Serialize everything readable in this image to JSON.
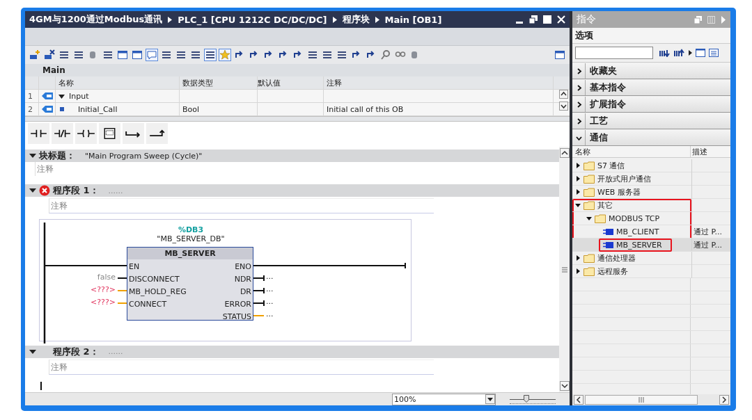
{
  "window": {
    "path": [
      "4GM与1200通过Modbus通讯",
      "PLC_1 [CPU 1212C DC/DC/DC]",
      "程序块",
      "Main [OB1]"
    ]
  },
  "interface": {
    "title": "Main",
    "columns": [
      "名称",
      "数据类型",
      "默认值",
      "注释"
    ],
    "rows": [
      {
        "num": "1",
        "name": "Input",
        "kind": "section",
        "expanded": true
      },
      {
        "num": "2",
        "name": "Initial_Call",
        "type": "Bool",
        "comment": "Initial call of this OB",
        "kind": "param"
      }
    ]
  },
  "block_title": {
    "label": "块标题：",
    "value": "\"Main Program Sweep (Cycle)\"",
    "comment": "注释",
    "expanded": true
  },
  "networks": [
    {
      "label": "程序段 1：",
      "dots": "......",
      "comment": "注释",
      "expanded": true,
      "error": true,
      "block": {
        "address": "%DB3",
        "instance": "\"MB_SERVER_DB\"",
        "name": "MB_SERVER",
        "inputs": [
          {
            "pin": "EN",
            "kind": "power"
          },
          {
            "pin": "DISCONNECT",
            "value": "false",
            "kind": "bool"
          },
          {
            "pin": "MB_HOLD_REG",
            "value": "<???>",
            "kind": "missing"
          },
          {
            "pin": "CONNECT",
            "value": "<???>",
            "kind": "missing"
          }
        ],
        "outputs": [
          {
            "pin": "ENO",
            "kind": "power"
          },
          {
            "pin": "NDR",
            "value": "...",
            "kind": "bool"
          },
          {
            "pin": "DR",
            "value": "...",
            "kind": "bool"
          },
          {
            "pin": "ERROR",
            "value": "...",
            "kind": "bool"
          },
          {
            "pin": "STATUS",
            "value": "...",
            "kind": "word"
          }
        ]
      }
    },
    {
      "label": "程序段 2：",
      "dots": "......",
      "comment": "注释",
      "expanded": true,
      "error": false
    }
  ],
  "zoom": "100%",
  "zoom_slider": {
    "level": 0.35
  },
  "panel": {
    "title": "指令",
    "options_label": "选项",
    "sections": [
      {
        "label": "收藏夹",
        "expanded": false
      },
      {
        "label": "基本指令",
        "expanded": false
      },
      {
        "label": "扩展指令",
        "expanded": false
      },
      {
        "label": "工艺",
        "expanded": false
      },
      {
        "label": "通信",
        "expanded": true
      }
    ],
    "columns": [
      "名称",
      "描述"
    ],
    "tree": [
      {
        "label": "S7 通信",
        "expanded": false,
        "annotated": false
      },
      {
        "label": "开放式用户通信",
        "expanded": false,
        "annotated": false
      },
      {
        "label": "WEB 服务器",
        "expanded": false,
        "annotated": false
      },
      {
        "label": "其它",
        "expanded": true,
        "annotated": true,
        "children": [
          {
            "label": "MODBUS TCP",
            "expanded": true,
            "children": [
              {
                "label": "MB_CLIENT",
                "description": "通过 P...",
                "selected": false,
                "annotated": false
              },
              {
                "label": "MB_SERVER",
                "description": "通过 P...",
                "selected": true,
                "annotated": true
              }
            ]
          }
        ]
      },
      {
        "label": "通信处理器",
        "expanded": false,
        "annotated": false
      },
      {
        "label": "远程服务",
        "expanded": false,
        "annotated": false
      }
    ]
  }
}
